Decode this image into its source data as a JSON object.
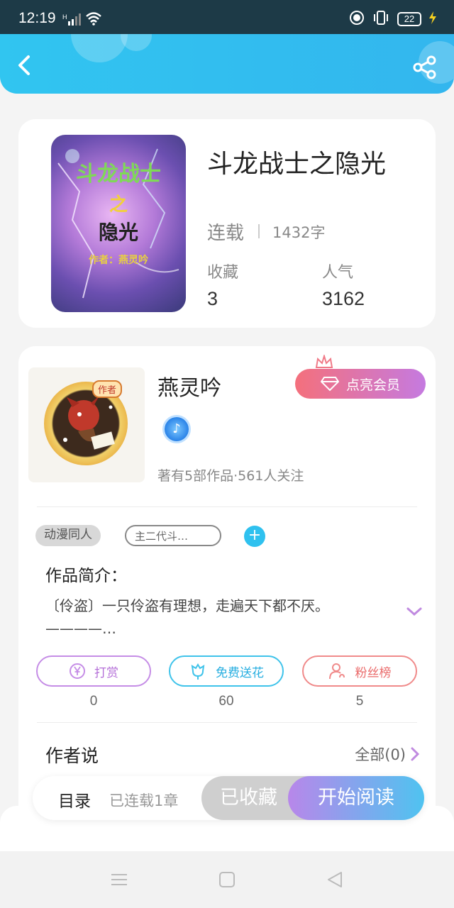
{
  "status_bar": {
    "time": "12:19",
    "signal_label": "H",
    "battery": "22"
  },
  "book": {
    "title": "斗龙战士之隐光",
    "cover_title_line1": "斗龙战士",
    "cover_title_line2": "之",
    "cover_title_line3": "隐光",
    "cover_author": "作者：燕灵吟",
    "serial_status": "连载",
    "word_count": "1432字",
    "favorites_label": "收藏",
    "favorites_value": "3",
    "popularity_label": "人气",
    "popularity_value": "3162"
  },
  "author": {
    "name": "燕灵吟",
    "avatar_badge": "作者",
    "vip_button": "点亮会员",
    "stats": "著有5部作品·561人关注"
  },
  "tags": {
    "tag1": "动漫同人",
    "tag2": "主二代斗…",
    "add": "+"
  },
  "intro": {
    "heading": "作品简介：",
    "text_line1": "〔伶盗〕一只伶盗有理想，走遍天下都不厌。",
    "text_line2": "————…"
  },
  "actions": {
    "tip_label": "打赏",
    "tip_count": "0",
    "flower_label": "免费送花",
    "flower_count": "60",
    "fans_label": "粉丝榜",
    "fans_count": "5"
  },
  "author_says": {
    "label": "作者说",
    "all_label": "全部(0)"
  },
  "bottom_bar": {
    "toc": "目录",
    "chapters": "已连载1章",
    "collected": "已收藏",
    "start_reading": "开始阅读"
  },
  "colors": {
    "header": "#31c5f0",
    "accent_blue": "#2fc1ef",
    "vip_pink": "#f4707c",
    "vip_purple": "#c57ae0"
  }
}
